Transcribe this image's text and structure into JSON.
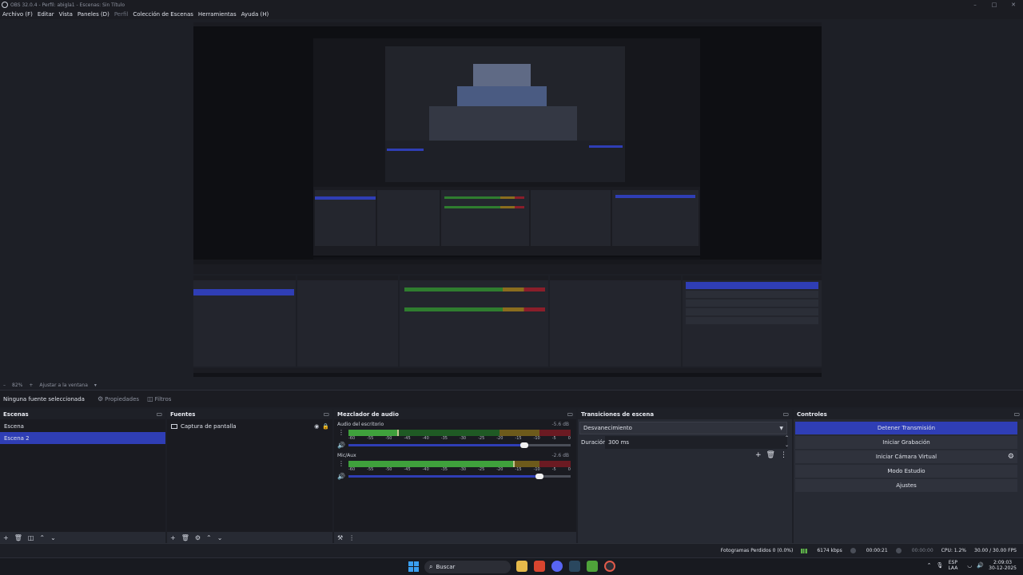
{
  "window": {
    "title": "OBS 32.0.4 - Perfil: abigla1 - Escenas: Sin Título",
    "controls": [
      "–",
      "□",
      "✕"
    ]
  },
  "menu": {
    "items": [
      "Archivo (F)",
      "Editar",
      "Vista",
      "Paneles (D)",
      "Perfil",
      "Colección de Escenas",
      "Herramientas",
      "Ayuda (H)"
    ]
  },
  "preview_footer": {
    "zoom": "82%",
    "fit": "Ajustar a la ventana"
  },
  "context_bar": {
    "no_source": "Ninguna fuente seleccionada",
    "properties": "Propiedades",
    "filters": "Filtros"
  },
  "scenes": {
    "title": "Escenas",
    "items": [
      {
        "label": "Escena",
        "selected": false
      },
      {
        "label": "Escena 2",
        "selected": true
      }
    ]
  },
  "sources": {
    "title": "Fuentes",
    "items": [
      {
        "label": "Captura de pantalla"
      }
    ]
  },
  "mixer": {
    "title": "Mezclador de audio",
    "ticks": [
      "-60",
      "-55",
      "-50",
      "-45",
      "-40",
      "-35",
      "-30",
      "-25",
      "-20",
      "-15",
      "-10",
      "-5",
      "0"
    ],
    "channels": [
      {
        "name": "Audio del escritorio",
        "db": "-5.6 dB",
        "volume": 0.79,
        "level": 0.22
      },
      {
        "name": "Mic/Aux",
        "db": "-2.6 dB",
        "volume": 0.86,
        "level": 0.74
      }
    ]
  },
  "transitions": {
    "title": "Transiciones de escena",
    "selected": "Desvanecimiento",
    "duration_label": "Duración",
    "duration_value": "300 ms"
  },
  "controls": {
    "title": "Controles",
    "buttons": [
      "Detener Transmisión",
      "Iniciar Grabación",
      "Iniciar Cámara Virtual",
      "Modo Estudio",
      "Ajustes"
    ]
  },
  "status": {
    "dropped": "Fotogramas Perdidos 0 (0.0%)",
    "bitrate": "6174 kbps",
    "stream_time": "00:00:21",
    "rec_time": "00:00:00",
    "cpu": "CPU: 1.2%",
    "fps": "30.00 / 30.00 FPS"
  },
  "taskbar": {
    "search": "Buscar",
    "lang_top": "ESP",
    "lang_bottom": "LAA",
    "time": "2:09:03",
    "date": "30-12-2025"
  },
  "colors": {
    "accent": "#2f3eb5",
    "panel": "#272a33",
    "background": "#1d1f26"
  }
}
